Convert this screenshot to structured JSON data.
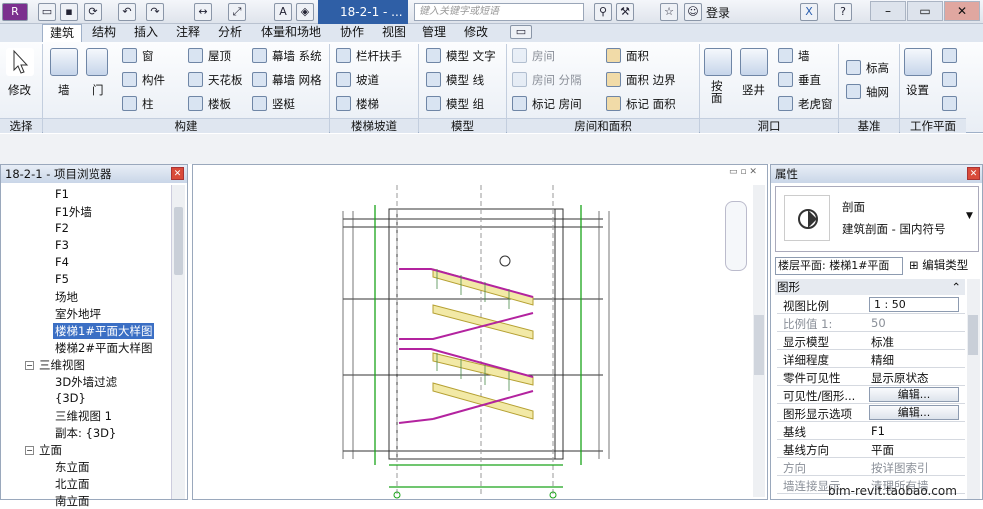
{
  "qat": {
    "doc_title": "18-2-1 - ...",
    "search_placeholder": "键入关键字或短语",
    "login": "登录"
  },
  "tabs": [
    "建筑",
    "结构",
    "插入",
    "注释",
    "分析",
    "体量和场地",
    "协作",
    "视图",
    "管理",
    "修改"
  ],
  "ribbon": {
    "modify": "修改",
    "select_panel": "选择",
    "wall": "墙",
    "door": "门",
    "window": "窗",
    "component": "构件",
    "column": "柱",
    "roof": "屋顶",
    "ceiling": "天花板",
    "floor": "楼板",
    "curtain_system": "幕墙 系统",
    "curtain_grid": "幕墙 网格",
    "mullion": "竖梃",
    "build_panel": "构建",
    "railing": "栏杆扶手",
    "ramp": "坡道",
    "stair": "楼梯",
    "stair_panel": "楼梯坡道",
    "model_text": "模型 文字",
    "model_line": "模型 线",
    "model_group": "模型 组",
    "model_panel": "模型",
    "room": "房间",
    "room_sep": "房间 分隔",
    "tag_room": "标记 房间",
    "area": "面积",
    "area_boundary": "面积 边界",
    "tag_area": "标记 面积",
    "room_panel": "房间和面积",
    "by_face": "按面",
    "shaft": "竖井",
    "wall_opening": "墙",
    "vertical": "垂直",
    "dormer": "老虎窗",
    "opening_panel": "洞口",
    "level": "标高",
    "grid": "轴网",
    "datum_panel": "基准",
    "set": "设置",
    "workplane_panel": "工作平面"
  },
  "browser": {
    "title": "18-2-1 - 项目浏览器",
    "items": [
      "F1",
      "F1外墙",
      "F2",
      "F3",
      "F4",
      "F5",
      "场地",
      "室外地坪",
      "楼梯1#平面大样图",
      "楼梯2#平面大样图"
    ],
    "view3d": "三维视图",
    "items3d": [
      "3D外墙过滤",
      "{3D}",
      "三维视图 1",
      "副本: {3D}"
    ],
    "elevation": "立面",
    "elev_items": [
      "东立面",
      "北立面",
      "南立面"
    ]
  },
  "props": {
    "title": "属性",
    "family": "剖面",
    "type": "建筑剖面 - 国内符号",
    "instance": "楼层平面: 楼梯1#平面",
    "edit_type": "编辑类型",
    "group": "图形",
    "rows": [
      {
        "name": "视图比例",
        "value": "1 : 50"
      },
      {
        "name": "比例值 1:",
        "value": "50"
      },
      {
        "name": "显示模型",
        "value": "标准"
      },
      {
        "name": "详细程度",
        "value": "精细"
      },
      {
        "name": "零件可见性",
        "value": "显示原状态"
      },
      {
        "name": "可见性/图形...",
        "value": "编辑..."
      },
      {
        "name": "图形显示选项",
        "value": "编辑..."
      },
      {
        "name": "基线",
        "value": "F1"
      },
      {
        "name": "基线方向",
        "value": "平面"
      },
      {
        "name": "方向",
        "value": "按详图索引"
      },
      {
        "name": "墙连接显示",
        "value": "清理所有墙"
      }
    ]
  },
  "watermark": "bim-revit.taobao.com"
}
